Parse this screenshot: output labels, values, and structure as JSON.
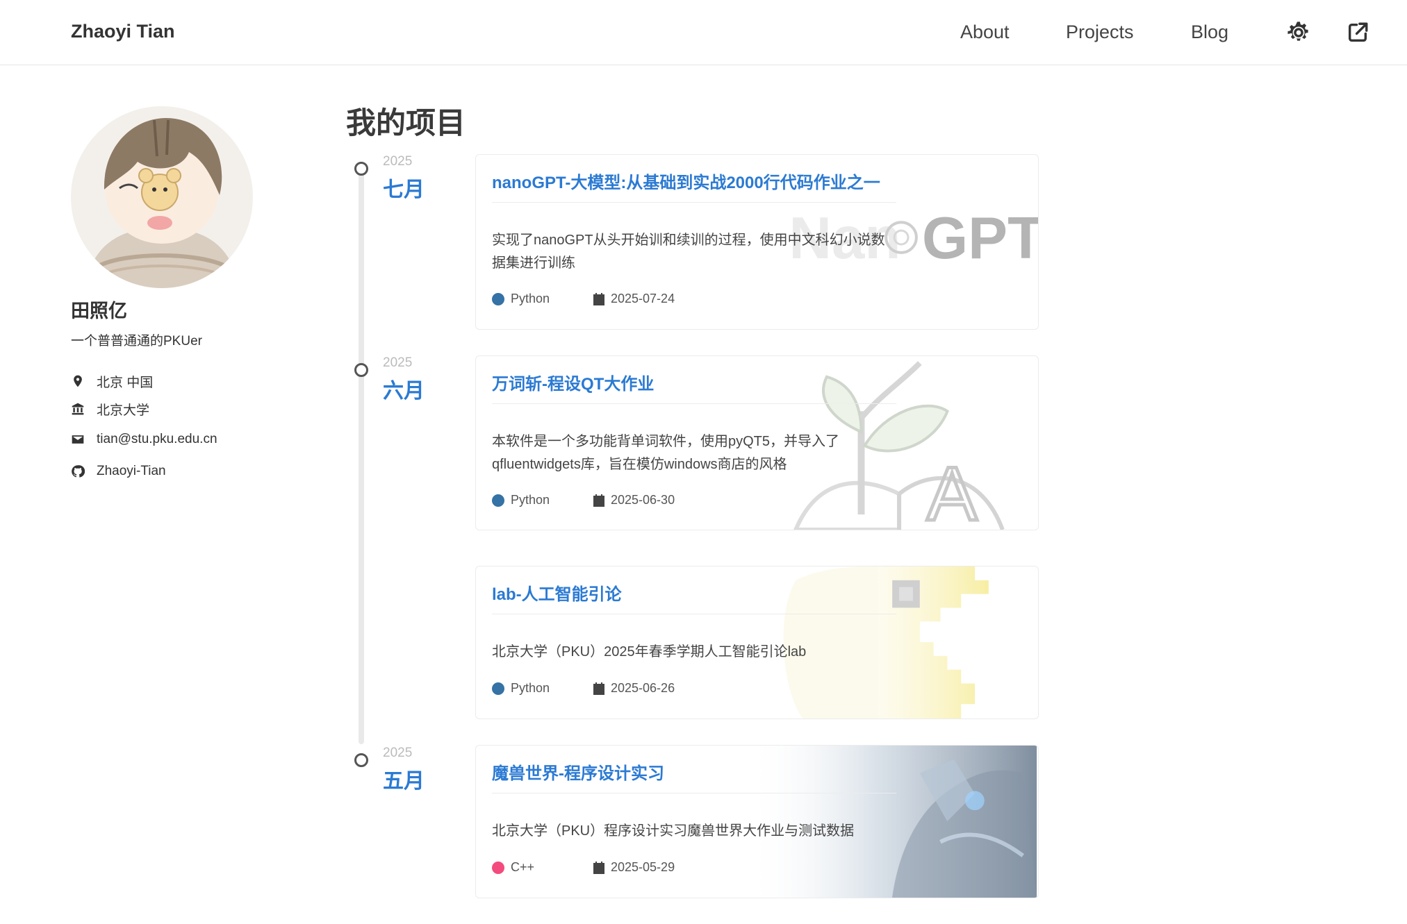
{
  "header": {
    "brand": "Zhaoyi Tian",
    "nav": [
      "About",
      "Projects",
      "Blog"
    ],
    "icons": [
      "gear-icon",
      "external-link-icon"
    ]
  },
  "sidebar": {
    "avatar_icon": "avatar",
    "name": "田照亿",
    "bio": "一个普普通通的PKUer",
    "location": "北京 中国",
    "organization": "北京大学",
    "email": "tian@stu.pku.edu.cn",
    "github": "Zhaoyi-Tian",
    "icons": [
      "map-marker-icon",
      "university-icon",
      "envelope-icon",
      "github-icon"
    ]
  },
  "main": {
    "title": "我的项目",
    "timeline": [
      {
        "year": "2025",
        "month": "七月"
      },
      {
        "year": "2025",
        "month": "六月"
      },
      {
        "year": "2025",
        "month": "五月"
      }
    ],
    "projects": [
      {
        "title": "nanoGPT-大模型:从基础到实战2000行代码作业之一",
        "description": "实现了nanoGPT从头开始训和续训的过程，使用中文科幻小说数据集进行训练",
        "language": "Python",
        "language_color": "#3572A5",
        "date": "2025-07-24",
        "bg_text_a": "Nan",
        "bg_text_b": "GPT"
      },
      {
        "title": "万词斩-程设QT大作业",
        "description": "本软件是一个多功能背单词软件，使用pyQT5，并导入了qfluentwidgets库，旨在模仿windows商店的风格",
        "language": "Python",
        "language_color": "#3572A5",
        "date": "2025-06-30",
        "bg_letter": "A"
      },
      {
        "title": "lab-人工智能引论",
        "description": "北京大学（PKU）2025年春季学期人工智能引论lab",
        "language": "Python",
        "language_color": "#3572A5",
        "date": "2025-06-26"
      },
      {
        "title": "魔兽世界-程序设计实习",
        "description": "北京大学（PKU）程序设计实习魔兽世界大作业与测试数据",
        "language": "C++",
        "language_color": "#f34b7d",
        "date": "2025-05-29"
      }
    ]
  },
  "colors": {
    "accent": "#2b7ad3",
    "python": "#3572A5",
    "cpp": "#f34b7d"
  }
}
